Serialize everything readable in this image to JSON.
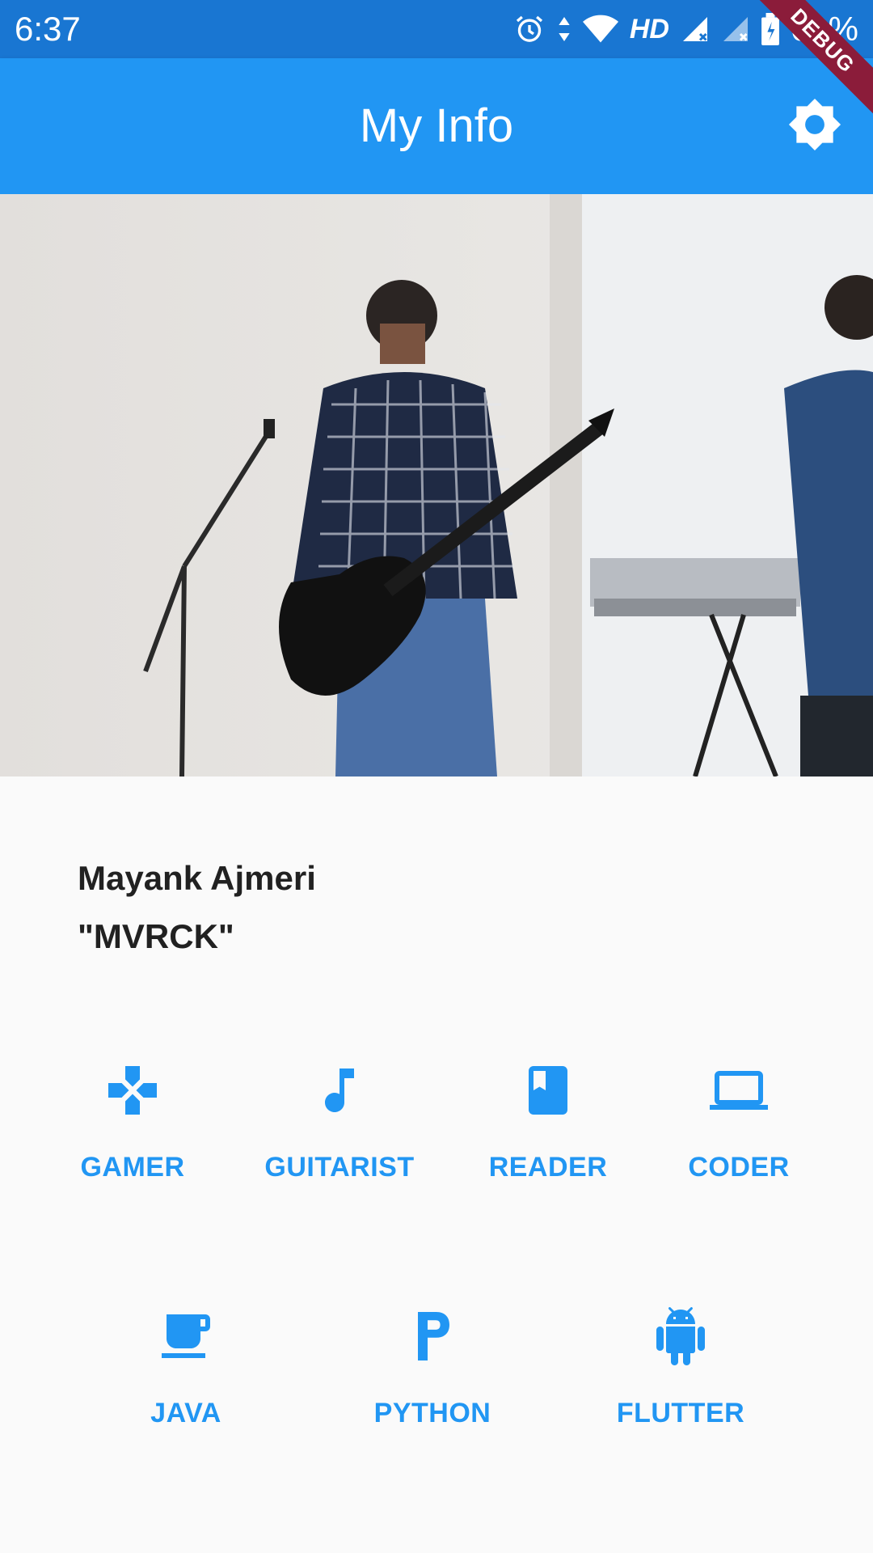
{
  "status_bar": {
    "time": "6:37",
    "network_label": "HD",
    "battery": "60%"
  },
  "debug_banner": "DEBUG",
  "app_bar": {
    "title": "My Info",
    "settings_icon": "brightness-icon"
  },
  "hero_image": {
    "subject": "guitarist-photo"
  },
  "profile": {
    "name": "Mayank Ajmeri",
    "nickname": "\"MVRCK\""
  },
  "skills_row_1": [
    {
      "label": "GAMER",
      "icon": "gamepad-icon"
    },
    {
      "label": "GUITARIST",
      "icon": "music-note-icon"
    },
    {
      "label": "READER",
      "icon": "book-icon"
    },
    {
      "label": "CODER",
      "icon": "laptop-icon"
    }
  ],
  "skills_row_2": [
    {
      "label": "JAVA",
      "icon": "coffee-icon"
    },
    {
      "label": "PYTHON",
      "icon": "letter-p-icon"
    },
    {
      "label": "FLUTTER",
      "icon": "android-icon"
    }
  ],
  "colors": {
    "accent": "#2196f3",
    "status_bar": "#1976d2",
    "text": "#212121",
    "debug": "#8b1c3a"
  }
}
